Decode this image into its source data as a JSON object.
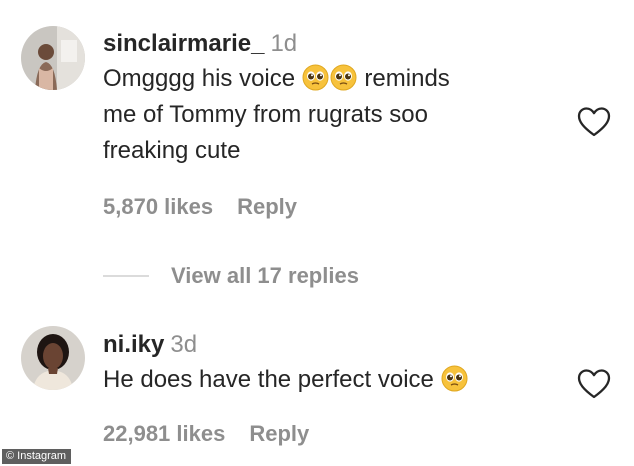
{
  "comments": [
    {
      "username": "sinclairmarie_",
      "time": "1d",
      "text_parts": [
        "Omgggg his voice ",
        " reminds",
        "me of Tommy from rugrats soo",
        "freaking cute"
      ],
      "likes": "5,870 likes",
      "reply_label": "Reply",
      "avatar_icon": "user-avatar-photo"
    },
    {
      "username": "ni.iky",
      "time": "3d",
      "text_parts": [
        "He does have the perfect voice "
      ],
      "likes": "22,981 likes",
      "reply_label": "Reply",
      "avatar_icon": "user-avatar-photo"
    }
  ],
  "view_replies_label": "View all 17 replies",
  "watermark": "© Instagram",
  "icons": {
    "emoji": "pleading-face-emoji",
    "like": "heart-outline-icon"
  },
  "colors": {
    "primary_text": "#262626",
    "secondary_text": "#8e8e8e",
    "divider": "#dbdbdb",
    "emoji": "#f7c23c"
  }
}
